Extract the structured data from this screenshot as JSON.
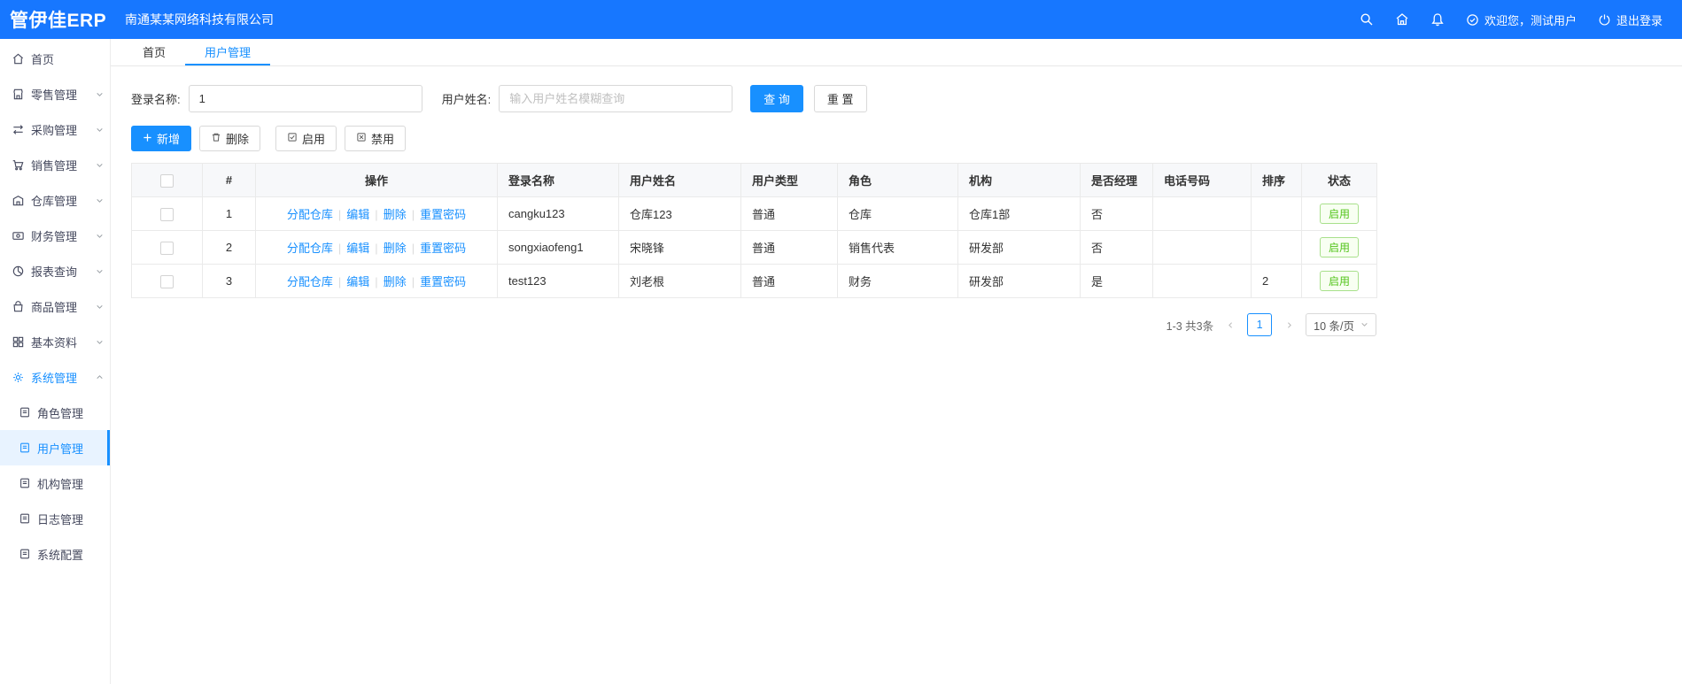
{
  "colors": {
    "header_blue": "#1777ff",
    "accent": "#1890ff",
    "success_green": "#52c41a"
  },
  "header": {
    "logo": "管伊佳ERP",
    "company": "南通某某网络科技有限公司",
    "welcome": "欢迎您，测试用户",
    "logout": "退出登录"
  },
  "sidebar": {
    "items": [
      {
        "label": "首页"
      },
      {
        "label": "零售管理"
      },
      {
        "label": "采购管理"
      },
      {
        "label": "销售管理"
      },
      {
        "label": "仓库管理"
      },
      {
        "label": "财务管理"
      },
      {
        "label": "报表查询"
      },
      {
        "label": "商品管理"
      },
      {
        "label": "基本资料"
      },
      {
        "label": "系统管理"
      }
    ],
    "submenu": [
      {
        "label": "角色管理"
      },
      {
        "label": "用户管理"
      },
      {
        "label": "机构管理"
      },
      {
        "label": "日志管理"
      },
      {
        "label": "系统配置"
      }
    ]
  },
  "tabs": [
    {
      "label": "首页"
    },
    {
      "label": "用户管理"
    }
  ],
  "search": {
    "login_label": "登录名称:",
    "login_value": "1",
    "name_label": "用户姓名:",
    "name_placeholder": "输入用户姓名模糊查询",
    "query_label": "查 询",
    "reset_label": "重 置"
  },
  "toolbar": {
    "add_label": "新增",
    "delete_label": "删除",
    "enable_label": "启用",
    "disable_label": "禁用"
  },
  "table": {
    "headers": [
      "#",
      "操作",
      "登录名称",
      "用户姓名",
      "用户类型",
      "角色",
      "机构",
      "是否经理",
      "电话号码",
      "排序",
      "状态"
    ],
    "op_links": [
      "分配仓库",
      "编辑",
      "删除",
      "重置密码"
    ],
    "op_separator": "|",
    "rows": [
      {
        "index": "1",
        "login": "cangku123",
        "name": "仓库123",
        "type": "普通",
        "role": "仓库",
        "org": "仓库1部",
        "manager": "否",
        "phone": "",
        "sort": "",
        "status": "启用"
      },
      {
        "index": "2",
        "login": "songxiaofeng1",
        "name": "宋晓锋",
        "type": "普通",
        "role": "销售代表",
        "org": "研发部",
        "manager": "否",
        "phone": "",
        "sort": "",
        "status": "启用"
      },
      {
        "index": "3",
        "login": "test123",
        "name": "刘老根",
        "type": "普通",
        "role": "财务",
        "org": "研发部",
        "manager": "是",
        "phone": "",
        "sort": "2",
        "status": "启用"
      }
    ]
  },
  "pagination": {
    "range_text": "1-3 共3条",
    "current_page": "1",
    "page_size": "10 条/页"
  }
}
